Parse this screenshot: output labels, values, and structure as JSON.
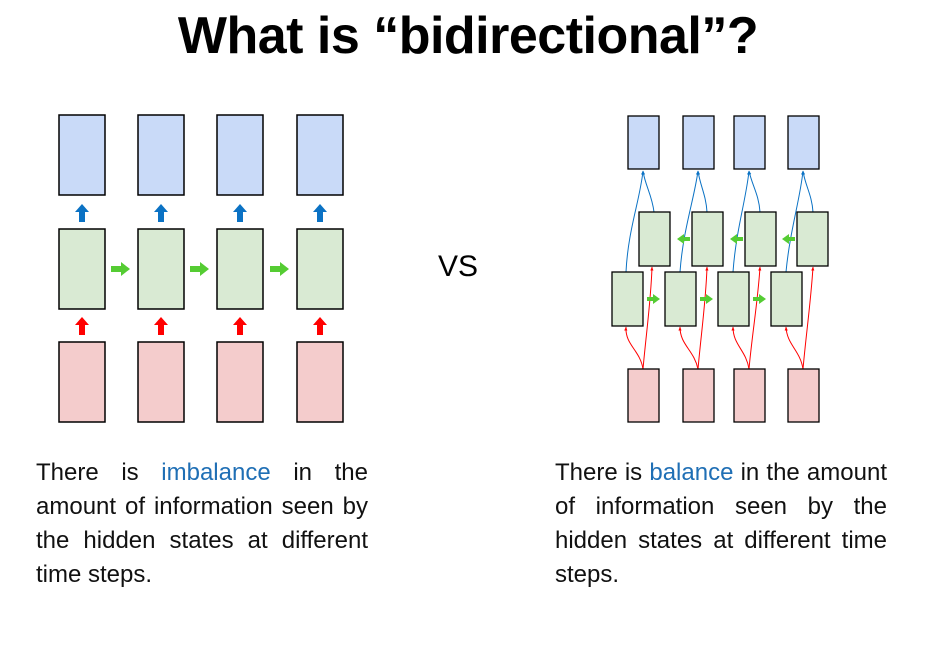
{
  "slide": {
    "title": "What is “bidirectional”?",
    "vs_label": "VS"
  },
  "left_caption": {
    "before": "There is ",
    "highlight": "imbalance",
    "after": " in the amount of information seen by the hidden states at different time steps."
  },
  "right_caption": {
    "before": "There is ",
    "highlight": "balance",
    "after": " in the amount of information seen by the hidden states at different time steps."
  },
  "colors": {
    "input_fill": "#f4cccc",
    "hidden_fill": "#d9ead3",
    "output_fill": "#c9daf8",
    "input_arrow": "#ff0000",
    "recurrent_arrow": "#55cc33",
    "output_arrow": "#0b72c4",
    "highlight_text": "#1f6fb5"
  }
}
